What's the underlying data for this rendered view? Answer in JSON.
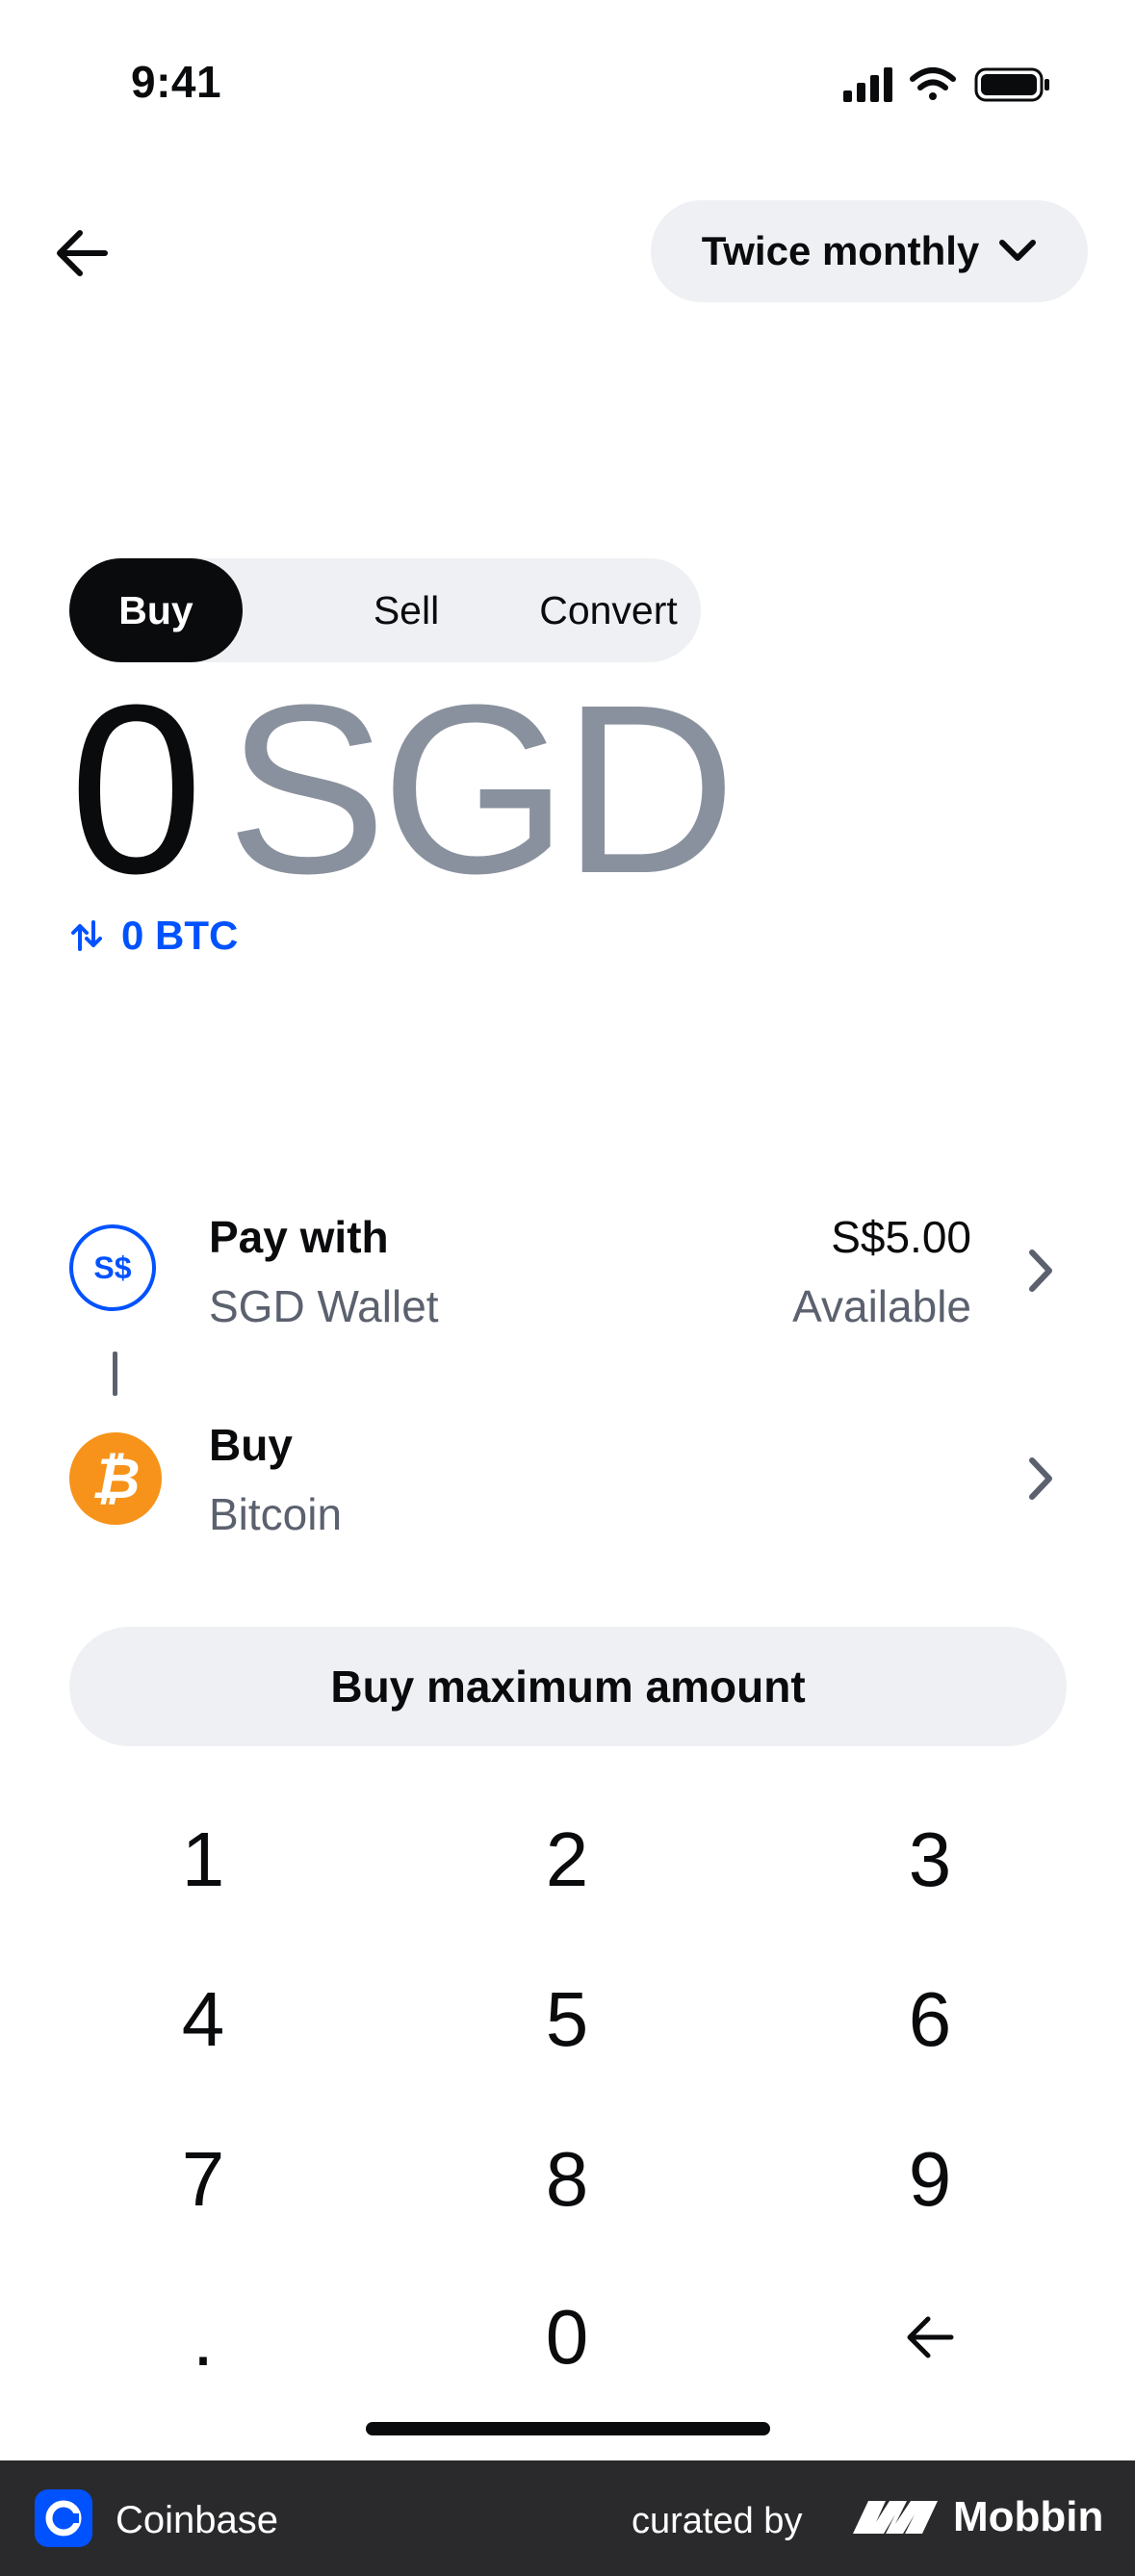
{
  "status_bar": {
    "time": "9:41"
  },
  "nav": {
    "frequency_label": "Twice monthly"
  },
  "tabs": [
    {
      "label": "Buy",
      "active": true
    },
    {
      "label": "Sell",
      "active": false
    },
    {
      "label": "Convert",
      "active": false
    }
  ],
  "amount": {
    "value": "0",
    "currency": "SGD",
    "converted": "0 BTC"
  },
  "pay_with": {
    "title": "Pay with",
    "subtitle": "SGD Wallet",
    "icon_text": "S$",
    "balance": "S$5.00",
    "balance_label": "Available"
  },
  "buy_asset": {
    "title": "Buy",
    "subtitle": "Bitcoin",
    "icon_text": "₿"
  },
  "max_button": {
    "label": "Buy maximum amount"
  },
  "keypad": {
    "k1": "1",
    "k2": "2",
    "k3": "3",
    "k4": "4",
    "k5": "5",
    "k6": "6",
    "k7": "7",
    "k8": "8",
    "k9": "9",
    "kdot": ".",
    "k0": "0"
  },
  "footer": {
    "app_name": "Coinbase",
    "curated_by": "curated by",
    "brand": "Mobbin"
  },
  "colors": {
    "accent": "#0052ff",
    "bitcoin": "#f7931a",
    "muted": "#8a919e",
    "pill": "#eef0f3"
  }
}
